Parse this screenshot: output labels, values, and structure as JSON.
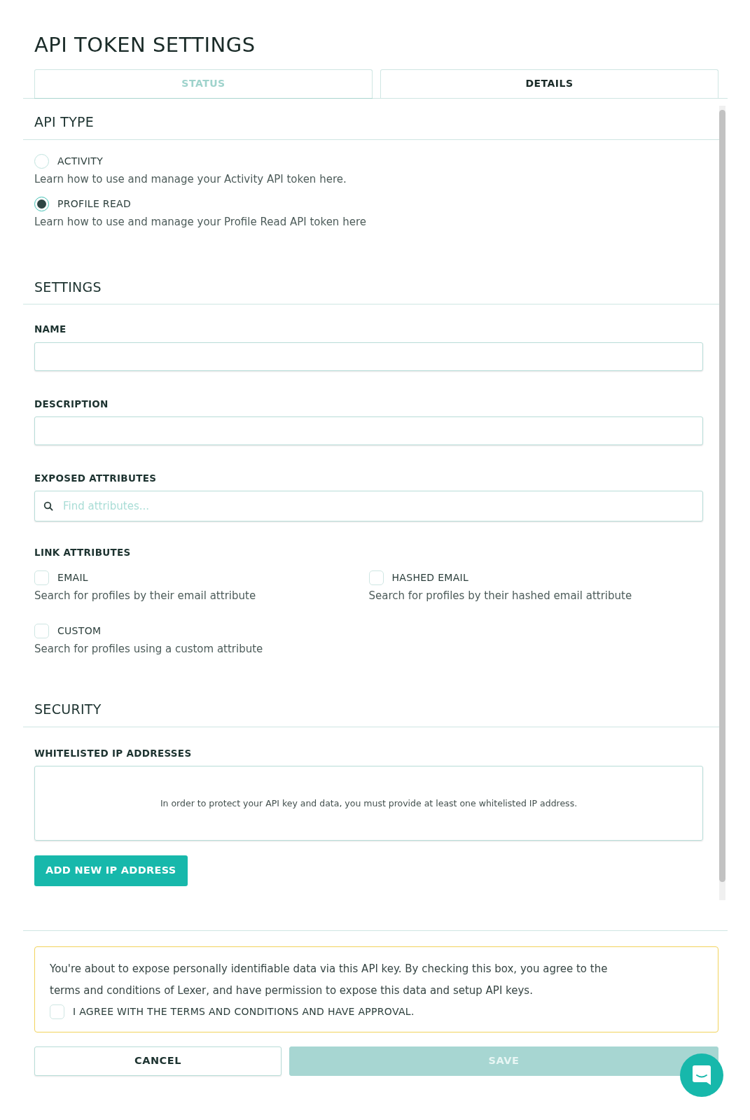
{
  "title": "API TOKEN SETTINGS",
  "tabs": [
    {
      "label": "STATUS",
      "selected": false
    },
    {
      "label": "DETAILS",
      "selected": true
    }
  ],
  "api_type": {
    "heading": "API TYPE",
    "options": [
      {
        "label": "ACTIVITY",
        "selected": false,
        "text": "Learn how to use and manage your Activity API token ",
        "link": "here",
        "after": "."
      },
      {
        "label": "PROFILE READ",
        "selected": true,
        "text": "Learn how to use and manage your Profile Read API token ",
        "link": "here"
      }
    ]
  },
  "settings": {
    "heading": "SETTINGS",
    "fields": [
      {
        "label": "NAME"
      },
      {
        "label": "DESCRIPTION"
      }
    ],
    "exposed_attributes": {
      "label": "EXPOSED ATTRIBUTES",
      "placeholder": "Find attributes..."
    },
    "link_attributes": {
      "label": "LINK ATTRIBUTES",
      "options": [
        {
          "label": "EMAIL",
          "checked": false,
          "description": "Search for profiles by their email attribute"
        },
        {
          "label": "HASHED EMAIL",
          "checked": false,
          "description": "Search for profiles by their hashed email attribute"
        },
        {
          "label": "CUSTOM",
          "checked": false,
          "description": "Search for profiles using a custom attribute"
        }
      ]
    }
  },
  "security": {
    "heading": "SECURITY",
    "label": "WHITELISTED IP ADDRESSES",
    "empty_message": "In order to protect your API key and data, you must provide at least one whitelisted IP address.",
    "button": "ADD NEW IP ADDRESS"
  },
  "agreement": {
    "text_before": "You're about to expose personally identifiable data via this API key. By checking this box, you agree to the ",
    "link": "terms and conditions",
    "text_after": " of Lexer, and have permission to expose this data and setup API keys.",
    "checkbox": {
      "label": "I AGREE WITH THE TERMS AND CONDITIONS AND HAVE APPROVAL.",
      "checked": false
    }
  },
  "buttons": [
    {
      "label": "CANCEL",
      "kind": "secondary",
      "disabled": false
    },
    {
      "label": "SAVE",
      "kind": "primary",
      "disabled": true
    }
  ]
}
